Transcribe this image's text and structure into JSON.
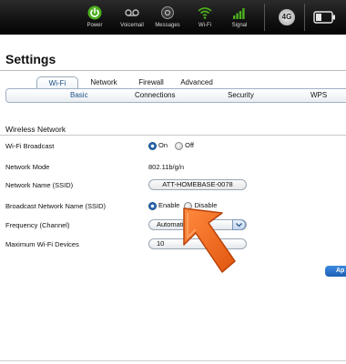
{
  "topbar": {
    "items": [
      {
        "label": "Power",
        "icon": "power-icon"
      },
      {
        "label": "Voicemail",
        "icon": "voicemail-icon"
      },
      {
        "label": "Messages",
        "icon": "messages-icon"
      },
      {
        "label": "Wi-Fi",
        "icon": "wifi-icon"
      },
      {
        "label": "Signal",
        "icon": "signal-icon"
      }
    ],
    "network_badge": "4G",
    "accent_green": "#4caf1e"
  },
  "page": {
    "title": "Settings"
  },
  "tabs": [
    {
      "label": "Wi-Fi",
      "active": true
    },
    {
      "label": "Network",
      "active": false
    },
    {
      "label": "Firewall",
      "active": false
    },
    {
      "label": "Advanced",
      "active": false
    }
  ],
  "subtabs": [
    {
      "label": "Basic",
      "active": true
    },
    {
      "label": "Connections",
      "active": false
    },
    {
      "label": "Security",
      "active": false
    },
    {
      "label": "WPS",
      "active": false
    }
  ],
  "section": {
    "title": "Wireless Network"
  },
  "fields": {
    "wifi_broadcast": {
      "label": "Wi-Fi Broadcast",
      "on": "On",
      "off": "Off",
      "selected": "On"
    },
    "network_mode": {
      "label": "Network Mode",
      "value": "802.11b/g/n"
    },
    "ssid": {
      "label": "Network Name (SSID)",
      "value": "ATT-HOMEBASE-0078"
    },
    "broadcast_ssid": {
      "label": "Broadcast Network Name (SSID)",
      "enable": "Enable",
      "disable": "Disable",
      "selected": "Enable"
    },
    "frequency": {
      "label": "Frequency (Channel)",
      "value": "Automatic"
    },
    "max_devices": {
      "label": "Maximum Wi-Fi Devices",
      "value": "10"
    }
  },
  "apply_button": {
    "label": "Ap"
  },
  "annotation": {
    "arrow_color": "#f26b1d"
  }
}
